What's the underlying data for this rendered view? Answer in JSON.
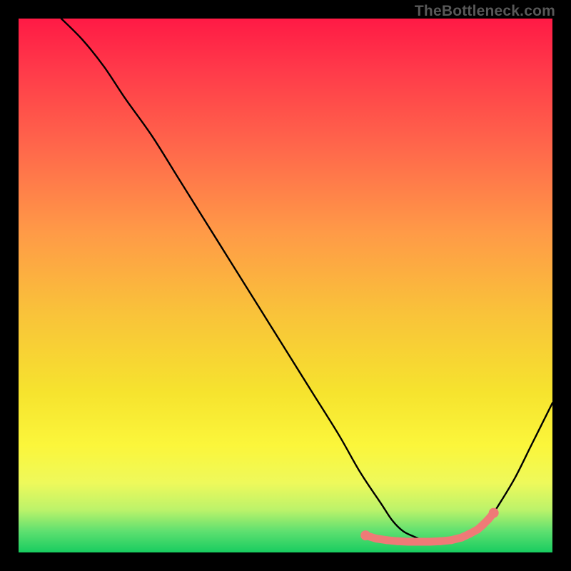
{
  "attribution": "TheBottleneck.com",
  "chart_data": {
    "type": "line",
    "title": "",
    "xlabel": "",
    "ylabel": "",
    "xlim": [
      0,
      100
    ],
    "ylim": [
      0,
      100
    ],
    "series": [
      {
        "name": "bottleneck-curve",
        "x": [
          8,
          12,
          16,
          20,
          25,
          30,
          35,
          40,
          45,
          50,
          55,
          60,
          64,
          68,
          70,
          72,
          74,
          76,
          78,
          80,
          82,
          84,
          86,
          88,
          90,
          93,
          96,
          100
        ],
        "values": [
          100,
          96,
          91,
          85,
          78,
          70,
          62,
          54,
          46,
          38,
          30,
          22,
          15,
          9,
          6,
          4,
          3,
          2.2,
          2,
          2,
          2.2,
          2.8,
          4,
          6,
          9,
          14,
          20,
          28
        ],
        "color": "#000000"
      }
    ],
    "highlight_points": {
      "name": "marker-band",
      "color": "#ef7a77",
      "x": [
        65,
        67,
        69,
        71,
        73,
        75,
        77,
        79,
        81,
        83,
        84.5,
        86,
        87,
        88,
        89
      ],
      "values": [
        3.2,
        2.6,
        2.3,
        2.1,
        2.0,
        2.0,
        2.0,
        2.1,
        2.3,
        2.8,
        3.5,
        4.3,
        5.2,
        6.2,
        7.4
      ]
    }
  }
}
